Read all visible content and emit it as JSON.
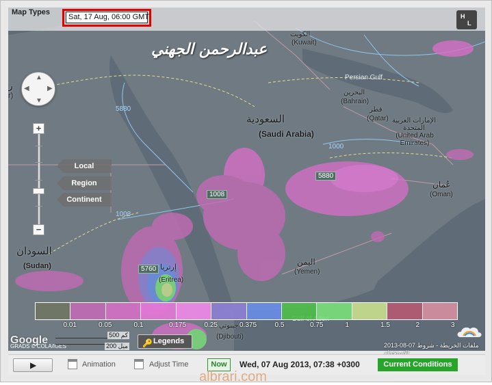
{
  "header": {
    "map_types_label": "Map Types",
    "forecast_time": "Sat, 17 Aug, 06:00 GMT",
    "hl_button": [
      "H",
      "L"
    ]
  },
  "watermark_text": "عبدالرحمن الجهني",
  "map_labels": {
    "kuwait": "الكويت\n(Kuwait)",
    "kuwait_ar": "الكويت",
    "kuwait_en": "(Kuwait)",
    "persian_gulf": "Persian Gulf",
    "bahrain_ar": "البحرين",
    "bahrain_en": "(Bahrain)",
    "qatar_ar": "قطر",
    "qatar_en": "(Qatar)",
    "uae_ar": "الإمارات العربية المتحدة",
    "uae_en": "(United Arab Emirates)",
    "saudi_ar": "السعودية",
    "saudi_en": "(Saudi Arabia)",
    "oman_ar": "عُمان",
    "oman_en": "(Oman)",
    "sudan_ar": "السودان",
    "sudan_en": "(Sudan)",
    "eritrea_ar": "إرتريا",
    "eritrea_en": "(Eritrea)",
    "yemen_ar": "اليمن",
    "yemen_en": "(Yemen)",
    "djibouti_ar": "جيبوتي",
    "djibouti_en": "(Djibouti)",
    "gulf_of_aden": "Gulf of Aden",
    "left_edge_ar": "ر",
    "left_edge_en": "r)"
  },
  "isobars": [
    "5880",
    "5880",
    "5760",
    "1008",
    "1008",
    "1000",
    "1000"
  ],
  "view_levels": [
    "Local",
    "Region",
    "Continent"
  ],
  "legend": {
    "values": [
      "0.01",
      "0.05",
      "0.1",
      "0.175",
      "0.25",
      "0.375",
      "0.5",
      "0.75",
      "1",
      "1.5",
      "2",
      "3"
    ],
    "colors": [
      "#6f7664",
      "#c26bb5",
      "#d46fc6",
      "#e678d9",
      "#f08ae8",
      "#8e7fd8",
      "#6a8ee8",
      "#4fbf4a",
      "#7be07a",
      "#c9e08d",
      "#b55a72",
      "#d68fa0"
    ]
  },
  "scale": {
    "top": "500 كم",
    "bottom": "200 ميل"
  },
  "google": {
    "logo": "Google",
    "sub": "GRADS © COLA/IGES"
  },
  "legends_button": "Legends",
  "datestamp": "2013-08-07 ملفات الخريطة - شروط الاستخدام",
  "toolbar": {
    "play_symbol": "▶",
    "animation_label": "Animation",
    "adjust_time_label": "Adjust Time",
    "now_label": "Now",
    "current_date": "Wed, 07 Aug 2013, 07:38 +0300",
    "current_conditions_label": "Current Conditions"
  },
  "footer_watermark": "albrari.com",
  "colors": {
    "map_land": "#6d7780",
    "map_water": "#66737e",
    "precip_pink": "#e07fd8",
    "toolbar_green": "#27a52b",
    "highlight_red": "#e10000"
  }
}
